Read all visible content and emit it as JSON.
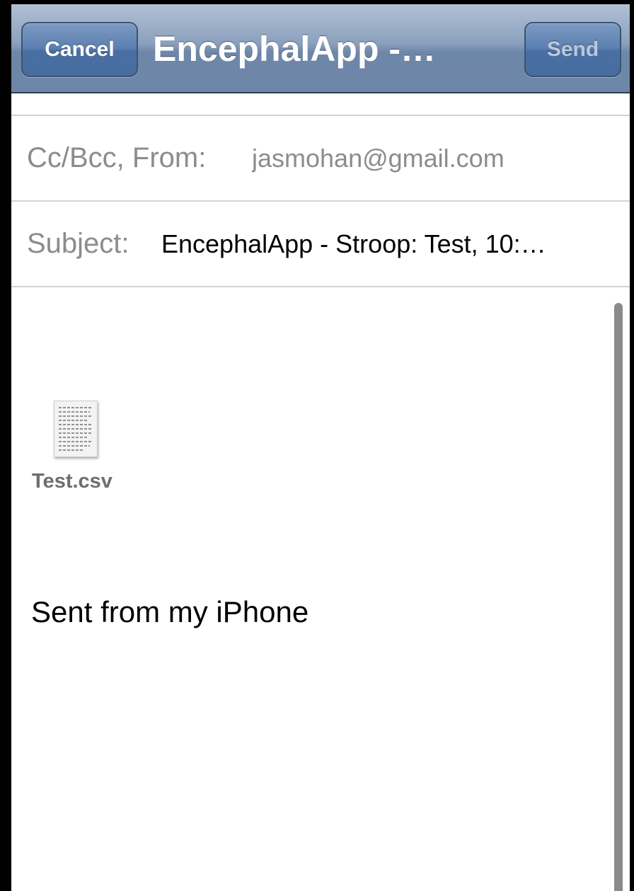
{
  "navbar": {
    "title": "EncephalApp -…",
    "cancel_label": "Cancel",
    "send_label": "Send"
  },
  "header_fields": {
    "ccbcc_from_label": "Cc/Bcc, From:",
    "from_value": "jasmohan@gmail.com",
    "subject_label": "Subject:",
    "subject_value": "EncephalApp - Stroop: Test, 10:…"
  },
  "body": {
    "attachment": {
      "filename": "Test.csv",
      "icon": "document-icon"
    },
    "signature": "Sent from my iPhone"
  },
  "colors": {
    "navbar": "#7f97b6",
    "button": "#5a7fb0",
    "label_gray": "#8c8c8c",
    "send_disabled": "#b9c8dc"
  }
}
